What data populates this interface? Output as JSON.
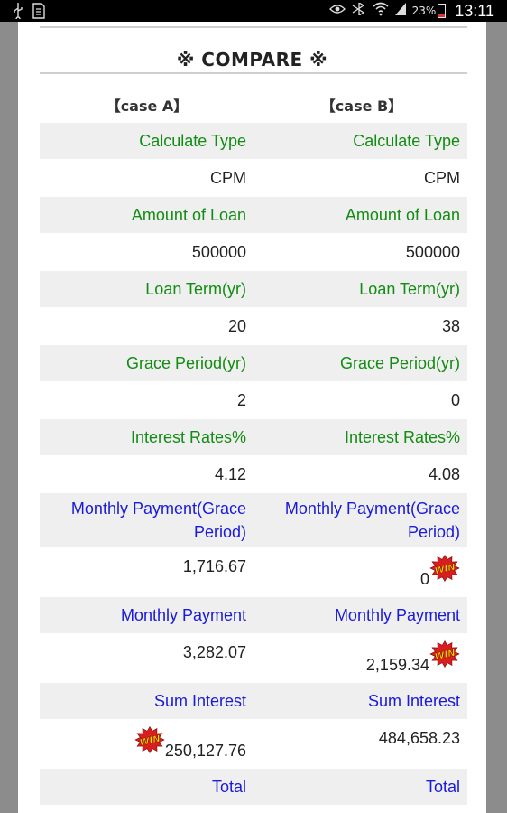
{
  "status_bar": {
    "left_icons": [
      "usb-icon",
      "sd-card-icon"
    ],
    "right_icons": [
      "eye-icon",
      "bluetooth-icon",
      "wifi-icon",
      "signal-icon"
    ],
    "battery_percent": "23%",
    "time": "13:11"
  },
  "page": {
    "title": "※ COMPARE ※",
    "case_a_header": "【case A】",
    "case_b_header": "【case B】"
  },
  "rows": {
    "calc_type": {
      "label": "Calculate Type",
      "a": "CPM",
      "b": "CPM"
    },
    "loan_amount": {
      "label": "Amount of Loan",
      "a": "500000",
      "b": "500000"
    },
    "loan_term": {
      "label": "Loan Term(yr)",
      "a": "20",
      "b": "38"
    },
    "grace_period": {
      "label": "Grace Period(yr)",
      "a": "2",
      "b": "0"
    },
    "interest_rate": {
      "label": "Interest Rates%",
      "a": "4.12",
      "b": "4.08"
    },
    "monthly_grace": {
      "label": "Monthly Payment(Grace Period)",
      "a": "1,716.67",
      "b": "0",
      "winner": "b"
    },
    "monthly_payment": {
      "label": "Monthly Payment",
      "a": "3,282.07",
      "b": "2,159.34",
      "winner": "b"
    },
    "sum_interest": {
      "label": "Sum Interest",
      "a": "250,127.76",
      "b": "484,658.23",
      "winner": "a"
    },
    "total": {
      "label": "Total"
    }
  },
  "badge": {
    "text": "WIN",
    "color": "#d81e1e",
    "text_color": "#ffd400"
  },
  "colors": {
    "label_green": "#128c12",
    "label_blue": "#1a1ad8",
    "row_shade": "#efefef"
  }
}
